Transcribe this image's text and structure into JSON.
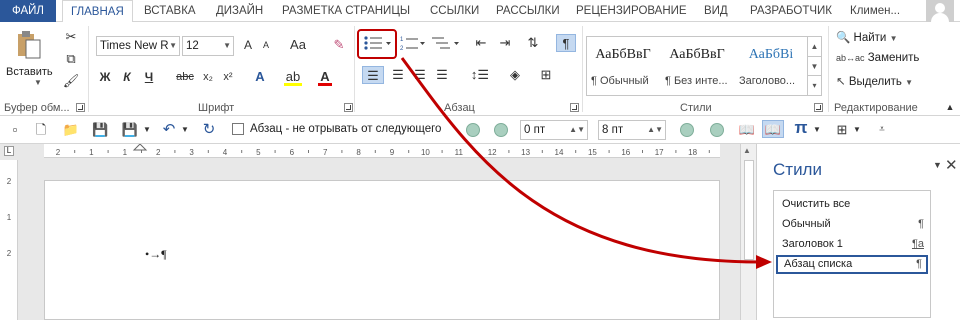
{
  "tabs": [
    {
      "label": "ФАЙЛ"
    },
    {
      "label": "ГЛАВНАЯ"
    },
    {
      "label": "ВСТАВКА"
    },
    {
      "label": "ДИЗАЙН"
    },
    {
      "label": "РАЗМЕТКА СТРАНИЦЫ"
    },
    {
      "label": "ССЫЛКИ"
    },
    {
      "label": "РАССЫЛКИ"
    },
    {
      "label": "РЕЦЕНЗИРОВАНИЕ"
    },
    {
      "label": "ВИД"
    },
    {
      "label": "РАЗРАБОТЧИК"
    }
  ],
  "user": {
    "name": "Климен..."
  },
  "clipboard": {
    "paste_label": "Вставить",
    "group_label": "Буфер обм..."
  },
  "font": {
    "name": "Times New R",
    "size": "12",
    "grow": "A",
    "shrink": "A",
    "case": "Aa",
    "group_label": "Шрифт"
  },
  "paragraph": {
    "group_label": "Абзац"
  },
  "styles": {
    "group_label": "Стили",
    "items": [
      {
        "sample": "АаБбВвГ",
        "name": "¶ Обычный"
      },
      {
        "sample": "АаБбВвГ",
        "name": "¶ Без инте..."
      },
      {
        "sample": "АаБбВі",
        "name": "Заголово..."
      }
    ]
  },
  "editing": {
    "find": "Найти",
    "replace": "Заменить",
    "select": "Выделить",
    "group_label": "Редактирование"
  },
  "qat": {
    "keep_with_next": "Абзац - не отрывать от следующего",
    "space_before": "0 пт",
    "space_after": "8 пт"
  },
  "ruler": {
    "marks": [
      "2",
      "1",
      "1",
      "2",
      "3",
      "4",
      "5",
      "6",
      "7",
      "8",
      "9",
      "10",
      "11",
      "12",
      "13",
      "14",
      "15",
      "16",
      "17",
      "18"
    ]
  },
  "vruler": {
    "marks": [
      "2",
      "1",
      "2"
    ]
  },
  "document": {
    "bullet": "•→¶"
  },
  "pane": {
    "title": "Стили",
    "items": [
      {
        "label": "Очистить все",
        "mark": ""
      },
      {
        "label": "Обычный",
        "mark": "¶"
      },
      {
        "label": "Заголовок 1",
        "mark": "¶a"
      },
      {
        "label": "Абзац списка",
        "mark": "¶"
      }
    ]
  },
  "colors": {
    "accent": "#2b579a",
    "annotation": "#c00000"
  }
}
